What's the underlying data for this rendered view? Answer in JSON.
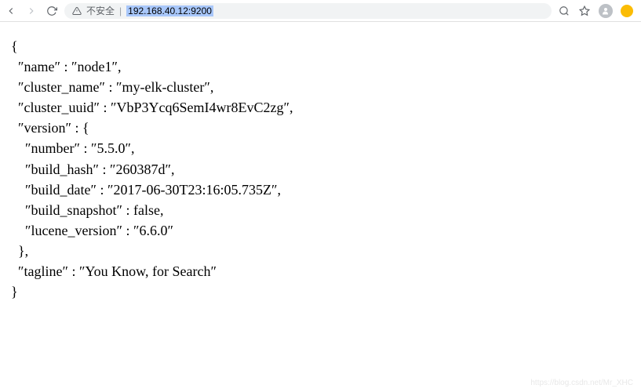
{
  "browser": {
    "not_secure_label": "不安全",
    "separator": "|",
    "url": "192.168.40.12:9200"
  },
  "response": {
    "name": "node1",
    "cluster_name": "my-elk-cluster",
    "cluster_uuid": "VbP3Ycq6SemI4wr8EvC2zg",
    "version": {
      "number": "5.5.0",
      "build_hash": "260387d",
      "build_date": "2017-06-30T23:16:05.735Z",
      "build_snapshot": "false",
      "lucene_version": "6.6.0"
    },
    "tagline": "You Know, for Search"
  },
  "labels": {
    "name": "″name″",
    "cluster_name": "″cluster_name″",
    "cluster_uuid": "″cluster_uuid″",
    "version": "″version″",
    "number": "″number″",
    "build_hash": "″build_hash″",
    "build_date": "″build_date″",
    "build_snapshot": "″build_snapshot″",
    "lucene_version": "″lucene_version″",
    "tagline": "″tagline″"
  },
  "watermark": "https://blog.csdn.net/Mr_XHC"
}
